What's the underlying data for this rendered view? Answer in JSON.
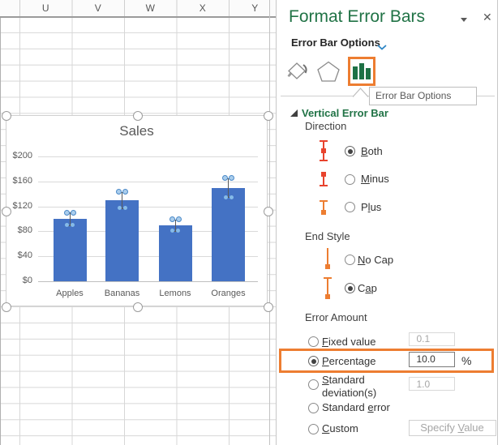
{
  "sheet": {
    "columns": [
      "U",
      "V",
      "W",
      "X",
      "Y"
    ]
  },
  "panel": {
    "title": "Format Error Bars",
    "close_glyph": "✕",
    "heading": "Error Bar Options",
    "tabs_tooltip": "Error Bar Options",
    "section_title": "Vertical Error Bar",
    "direction": {
      "label": "Direction",
      "options": [
        {
          "label": "Both",
          "accel": "B",
          "selected": true,
          "icon": "error-bar-both-icon"
        },
        {
          "label": "Minus",
          "accel": "M",
          "selected": false,
          "icon": "error-bar-minus-icon"
        },
        {
          "label": "Plus",
          "accel": "l",
          "selected": false,
          "icon": "error-bar-plus-icon"
        }
      ]
    },
    "end_style": {
      "label": "End Style",
      "options": [
        {
          "label": "No Cap",
          "accel": "N",
          "selected": false,
          "icon": "no-cap-icon"
        },
        {
          "label": "Cap",
          "accel": "a",
          "selected": true,
          "icon": "cap-icon"
        }
      ]
    },
    "error_amount": {
      "label": "Error Amount",
      "options": [
        {
          "label": "Fixed value",
          "accel": "F",
          "selected": false,
          "field": "0.1"
        },
        {
          "label": "Percentage",
          "accel": "P",
          "selected": true,
          "field": "10.0",
          "suffix": "%",
          "highlighted": true
        },
        {
          "label": "Standard deviation(s)",
          "accel": "S",
          "selected": false,
          "field": "1.0"
        },
        {
          "label": "Standard error",
          "accel": "e",
          "selected": false
        },
        {
          "label": "Custom",
          "accel": "C",
          "selected": false,
          "button": {
            "label": "Specify Value",
            "accel": "V"
          }
        }
      ]
    }
  },
  "chart_data": {
    "type": "bar",
    "title": "Sales",
    "categories": [
      "Apples",
      "Bananas",
      "Lemons",
      "Oranges"
    ],
    "values": [
      100,
      130,
      90,
      150
    ],
    "bar_color": "#4472C4",
    "error_bars": {
      "type": "percentage",
      "value": 10
    },
    "ylim": [
      0,
      200
    ],
    "yticks": [
      0,
      40,
      80,
      120,
      160,
      200
    ],
    "ytick_labels": [
      "$0",
      "$40",
      "$80",
      "$120",
      "$160",
      "$200"
    ],
    "grid": true,
    "legend": "none",
    "selected": true
  },
  "colors": {
    "accent_green": "#217346",
    "icon_red": "#E8432D",
    "icon_orange": "#ED7D31",
    "highlight_orange": "#ED7D31",
    "bar_blue": "#4472C4",
    "icon_bar_green": "#1E7145"
  }
}
